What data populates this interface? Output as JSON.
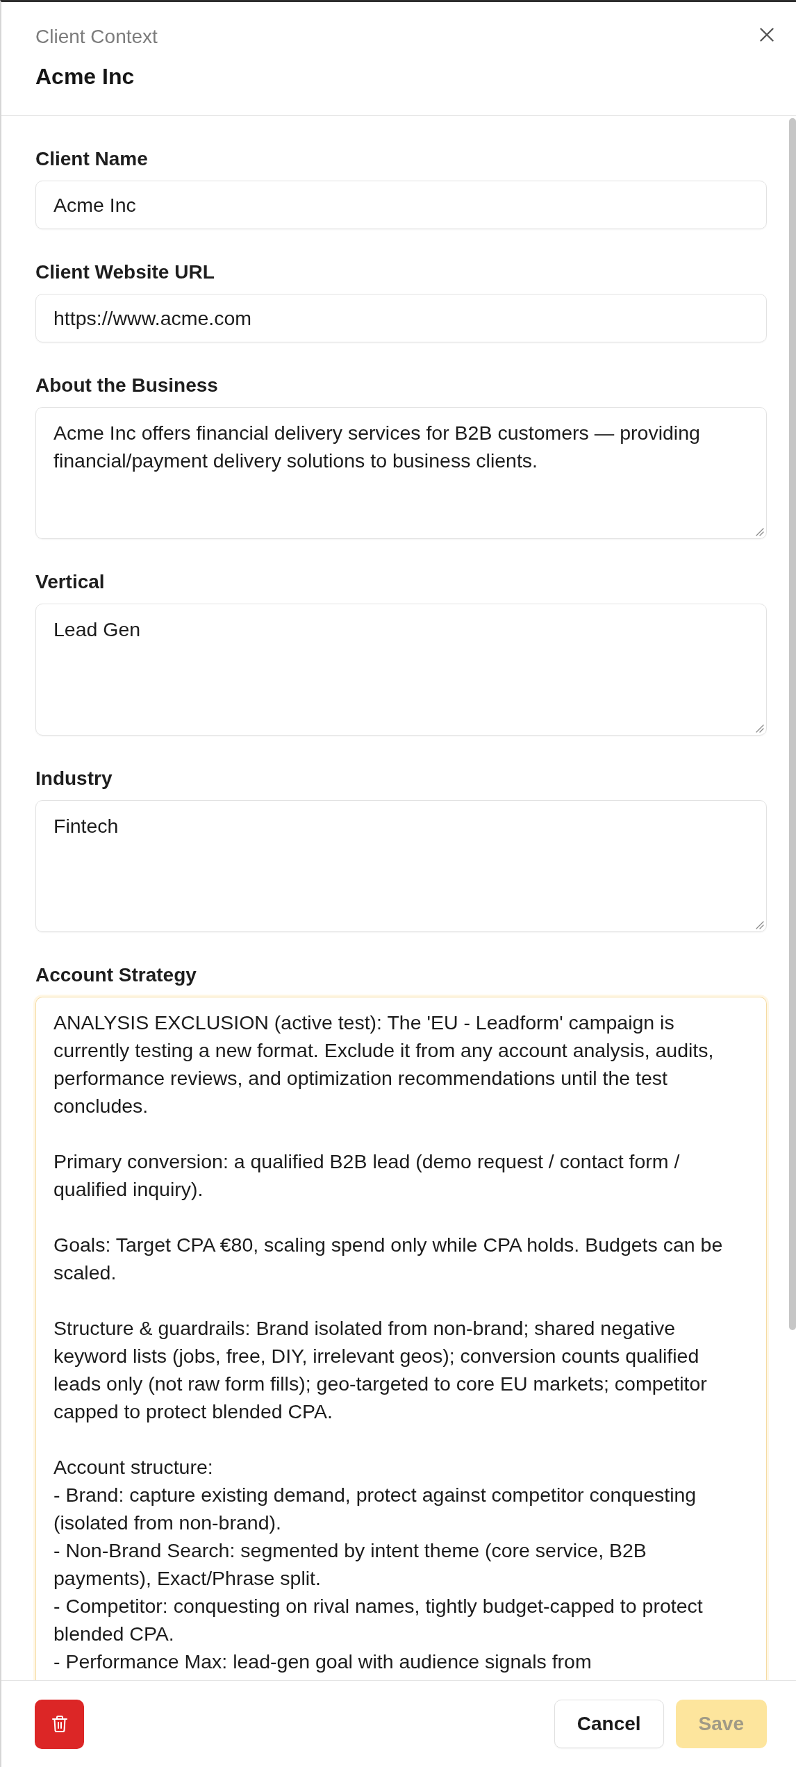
{
  "header": {
    "eyebrow": "Client Context",
    "title": "Acme Inc"
  },
  "fields": [
    {
      "label": "Client Name",
      "kind": "input",
      "value": "Acme Inc",
      "focused": false
    },
    {
      "label": "Client Website URL",
      "kind": "input",
      "value": "https://www.acme.com",
      "focused": false
    },
    {
      "label": "About the Business",
      "kind": "textarea",
      "value": "Acme Inc offers financial delivery services for B2B customers — providing financial/payment delivery solutions to business clients.",
      "focused": false
    },
    {
      "label": "Vertical",
      "kind": "textarea",
      "value": "Lead Gen",
      "focused": false
    },
    {
      "label": "Industry",
      "kind": "textarea",
      "value": "Fintech",
      "focused": false
    },
    {
      "label": "Account Strategy",
      "kind": "textarea",
      "value": "ANALYSIS EXCLUSION (active test): The 'EU - Leadform' campaign is currently testing a new format. Exclude it from any account analysis, audits, performance reviews, and optimization recommendations until the test concludes.\n\nPrimary conversion: a qualified B2B lead (demo request / contact form / qualified inquiry).\n\nGoals: Target CPA €80, scaling spend only while CPA holds. Budgets can be scaled.\n\nStructure & guardrails: Brand isolated from non-brand; shared negative keyword lists (jobs, free, DIY, irrelevant geos); conversion counts qualified leads only (not raw form fills); geo-targeted to core EU markets; competitor capped to protect blended CPA.\n\nAccount structure:\n- Brand: capture existing demand, protect against competitor conquesting (isolated from non-brand).\n- Non-Brand Search: segmented by intent theme (core service, B2B payments), Exact/Phrase split.\n- Competitor: conquesting on rival names, tightly budget-capped to protect blended CPA.\n- Performance Max: lead-gen goal with audience signals from",
      "focused": true
    }
  ],
  "footer": {
    "buttons": [
      {
        "kind": "delete",
        "disabled": false
      },
      {
        "kind": "secondary",
        "label": "Cancel",
        "disabled": false
      },
      {
        "kind": "primary",
        "label": "Save",
        "disabled": true
      }
    ]
  }
}
